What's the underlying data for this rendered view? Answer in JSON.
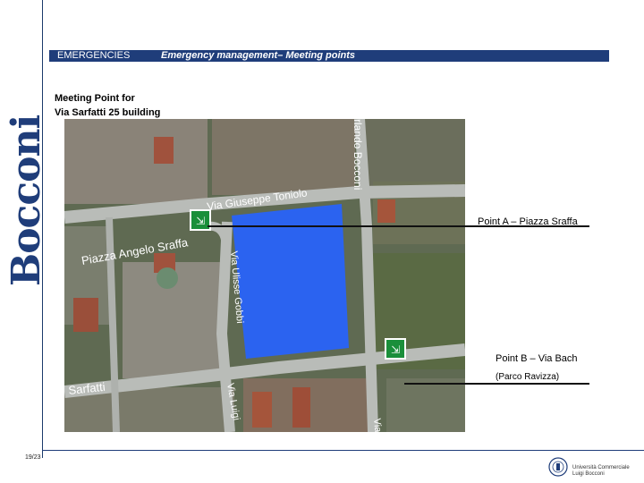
{
  "brand": {
    "logo_text": "Bocconi",
    "color": "#1f3d7a"
  },
  "header": {
    "section": "EMERGENCIES",
    "title": "Emergency management– Meeting points"
  },
  "meeting": {
    "line1": "Meeting Point for",
    "line2": "Via Sarfatti 25 building"
  },
  "map": {
    "street_labels": [
      "Via Giuseppe Toniolo",
      "Piazza Angelo Sraffa",
      "Via Ulisse Gobbi",
      "Sarfatti",
      "Via Luigi",
      "Via"
    ],
    "vertical_street_label": "rlando Bocconi",
    "icon": "assembly-point-icon",
    "highlight_color": "#2b63f0"
  },
  "points": {
    "a_label": "Point A – Piazza Sraffa",
    "b_label": "Point B – Via Bach",
    "b_sub": "(Parco Ravizza)"
  },
  "footer": {
    "page": "19/23",
    "uni_line1": "Università Commerciale",
    "uni_line2": "Luigi Bocconi"
  }
}
